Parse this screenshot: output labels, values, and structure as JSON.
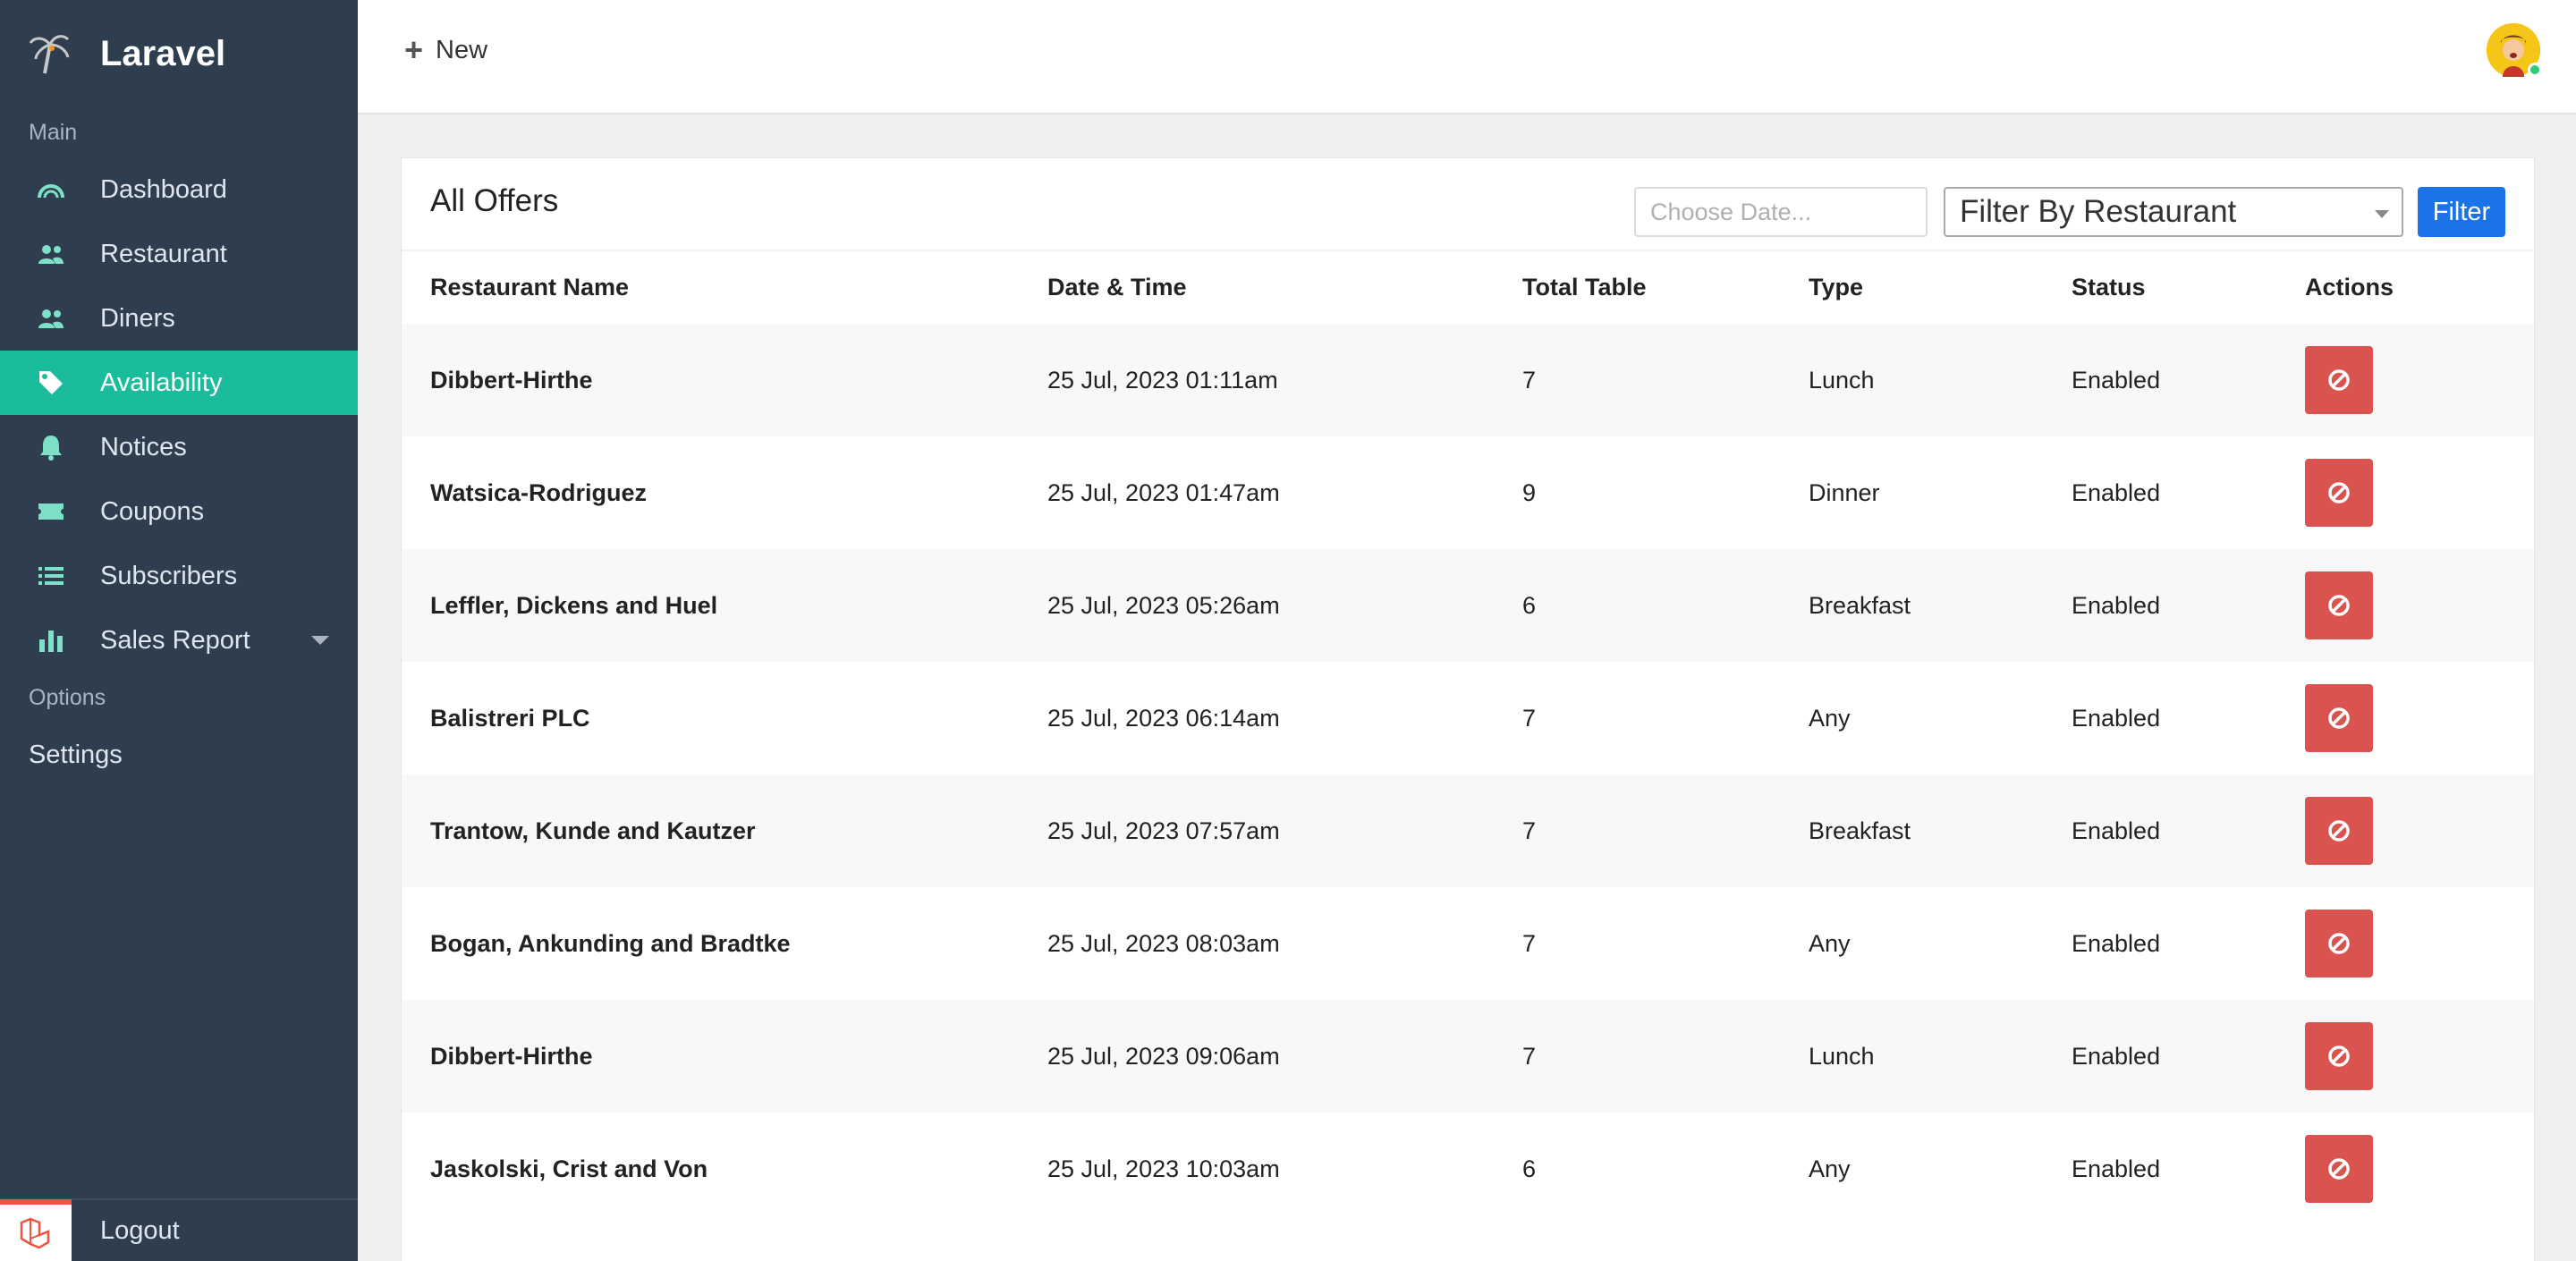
{
  "sidebar": {
    "brand": "Laravel",
    "section_main": "Main",
    "section_options": "Options",
    "items": [
      {
        "label": "Dashboard",
        "icon": "dashboard-gauge-icon"
      },
      {
        "label": "Restaurant",
        "icon": "users-icon"
      },
      {
        "label": "Diners",
        "icon": "users-icon"
      },
      {
        "label": "Availability",
        "icon": "tag-icon",
        "active": true
      },
      {
        "label": "Notices",
        "icon": "bell-icon"
      },
      {
        "label": "Coupons",
        "icon": "ticket-icon"
      },
      {
        "label": "Subscribers",
        "icon": "list-icon"
      },
      {
        "label": "Sales Report",
        "icon": "bar-chart-icon"
      }
    ],
    "settings": "Settings",
    "logout": "Logout"
  },
  "topbar": {
    "new_label": "New"
  },
  "card": {
    "title": "All Offers",
    "date_placeholder": "Choose Date...",
    "restaurant_filter": "Filter By Restaurant",
    "filter_button": "Filter"
  },
  "table": {
    "headers": [
      "Restaurant Name",
      "Date & Time",
      "Total Table",
      "Type",
      "Status",
      "Actions"
    ],
    "rows": [
      {
        "name": "Dibbert-Hirthe",
        "datetime": "25 Jul, 2023 01:11am",
        "tables": "7",
        "type": "Lunch",
        "status": "Enabled"
      },
      {
        "name": "Watsica-Rodriguez",
        "datetime": "25 Jul, 2023 01:47am",
        "tables": "9",
        "type": "Dinner",
        "status": "Enabled"
      },
      {
        "name": "Leffler, Dickens and Huel",
        "datetime": "25 Jul, 2023 05:26am",
        "tables": "6",
        "type": "Breakfast",
        "status": "Enabled"
      },
      {
        "name": "Balistreri PLC",
        "datetime": "25 Jul, 2023 06:14am",
        "tables": "7",
        "type": "Any",
        "status": "Enabled"
      },
      {
        "name": "Trantow, Kunde and Kautzer",
        "datetime": "25 Jul, 2023 07:57am",
        "tables": "7",
        "type": "Breakfast",
        "status": "Enabled"
      },
      {
        "name": "Bogan, Ankunding and Bradtke",
        "datetime": "25 Jul, 2023 08:03am",
        "tables": "7",
        "type": "Any",
        "status": "Enabled"
      },
      {
        "name": "Dibbert-Hirthe",
        "datetime": "25 Jul, 2023 09:06am",
        "tables": "7",
        "type": "Lunch",
        "status": "Enabled"
      },
      {
        "name": "Jaskolski, Crist and Von",
        "datetime": "25 Jul, 2023 10:03am",
        "tables": "6",
        "type": "Any",
        "status": "Enabled"
      }
    ]
  },
  "colors": {
    "sidebar_bg": "#2f3e4e",
    "active_item": "#1abc9c",
    "filter_button": "#1a73e8",
    "action_button": "#d9534f"
  }
}
